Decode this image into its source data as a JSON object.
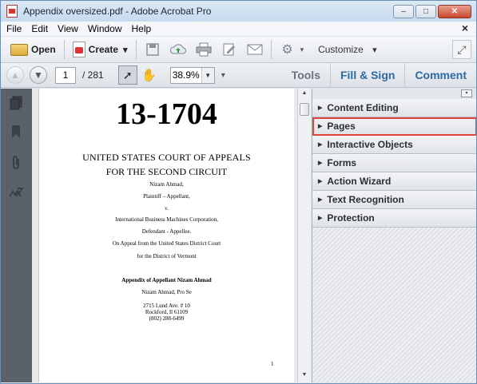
{
  "window": {
    "title": "Appendix oversized.pdf - Adobe Acrobat Pro",
    "minimize": "▭",
    "maximize": "□",
    "close": "✕"
  },
  "menu": [
    "File",
    "Edit",
    "View",
    "Window",
    "Help"
  ],
  "menu_close": "×",
  "toolbar": {
    "open_label": "Open",
    "create_label": "Create",
    "create_arrow": "▾",
    "customize_label": "Customize",
    "customize_arrow": "▾",
    "icons": [
      "save-icon",
      "cloud-upload-icon",
      "print-icon",
      "edit-icon",
      "email-icon",
      "settings-icon"
    ]
  },
  "nav": {
    "current_page": "1",
    "total_pages": "/ 281",
    "zoom": "38.9%",
    "zoom_arrow": "▼"
  },
  "panes": {
    "tools": "Tools",
    "fill_sign": "Fill & Sign",
    "comment": "Comment"
  },
  "document": {
    "case_number": "13-1704",
    "court_line1": "UNITED STATES COURT OF APPEALS",
    "court_line2": "FOR THE SECOND CIRCUIT",
    "plaintiff_name": "Nizam Ahmad,",
    "plaintiff_role": "Plaintiff – Appellant,",
    "versus": "v.",
    "defendant_name": "International Business Machines Corporation,",
    "defendant_role": "Defendant - Appellee.",
    "appeal_line1": "On Appeal from the United States District Court",
    "appeal_line2": "for the District of Vermont",
    "appendix_title": "Appendix of Appellant Nizam Ahmad",
    "pro_se": "Nizam Ahmad, Pro Se",
    "address1": "2715 Lund Ave. # 10",
    "address2": "Rockford, Il 61109",
    "phone": "(802) 288-6499",
    "page_number": "1"
  },
  "tool_panels": [
    {
      "label": "Content Editing",
      "selected": false
    },
    {
      "label": "Pages",
      "selected": true
    },
    {
      "label": "Interactive Objects",
      "selected": false
    },
    {
      "label": "Forms",
      "selected": false
    },
    {
      "label": "Action Wizard",
      "selected": false
    },
    {
      "label": "Text Recognition",
      "selected": false
    },
    {
      "label": "Protection",
      "selected": false
    }
  ],
  "colors": {
    "selection_outline": "#e0453a",
    "link_blue": "#2c6aa3"
  }
}
